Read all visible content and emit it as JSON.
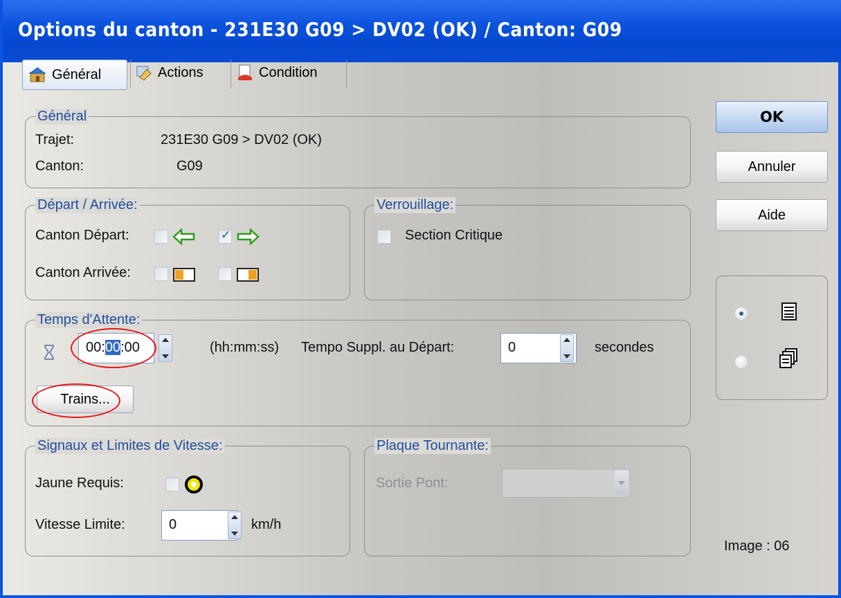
{
  "window": {
    "title": "Options du canton - 231E30 G09 > DV02 (OK) / Canton: G09"
  },
  "tabs": [
    {
      "label": "Général",
      "icon": "general-icon",
      "active": true
    },
    {
      "label": "Actions",
      "icon": "actions-icon",
      "active": false
    },
    {
      "label": "Condition",
      "icon": "condition-icon",
      "active": false
    }
  ],
  "general": {
    "legend": "Général",
    "trajet_label": "Trajet:",
    "trajet_value": "231E30 G09 > DV02 (OK)",
    "canton_label": "Canton:",
    "canton_value": "G09"
  },
  "depart_arrivee": {
    "legend": "Départ / Arrivée:",
    "canton_depart_label": "Canton Départ:",
    "canton_arrivee_label": "Canton Arrivée:",
    "depart_left_checked": false,
    "depart_right_checked": true,
    "arrivee_left_checked": false,
    "arrivee_right_checked": false
  },
  "verrouillage": {
    "legend": "Verrouillage:",
    "section_critique_label": "Section Critique",
    "section_critique_checked": false
  },
  "temps_attente": {
    "legend": "Temps d'Attente:",
    "time_hh": "00:",
    "time_mm": "00",
    "time_ss": ":00",
    "format_label": "(hh:mm:ss)",
    "tempo_label": "Tempo Suppl. au Départ:",
    "tempo_value": "0",
    "tempo_unit": "secondes",
    "trains_button": "Trains..."
  },
  "signaux": {
    "legend": "Signaux et Limites de Vitesse:",
    "jaune_label": "Jaune Requis:",
    "jaune_checked": false,
    "vitesse_label": "Vitesse Limite:",
    "vitesse_value": "0",
    "vitesse_unit": "km/h"
  },
  "plaque_tournante": {
    "legend": "Plaque Tournante:",
    "sortie_pont_label": "Sortie Pont:",
    "sortie_pont_value": ""
  },
  "buttons": {
    "ok": "OK",
    "annuler": "Annuler",
    "aide": "Aide"
  },
  "view_options": [
    {
      "icon": "list-view-icon",
      "selected": true
    },
    {
      "icon": "multi-window-icon",
      "selected": false
    }
  ],
  "image_label": "Image : 06",
  "colors": {
    "title_bar": "#0548cf",
    "legend_text": "#1f4e9e",
    "highlight": "#e2181e",
    "selection": "#316ac5"
  }
}
